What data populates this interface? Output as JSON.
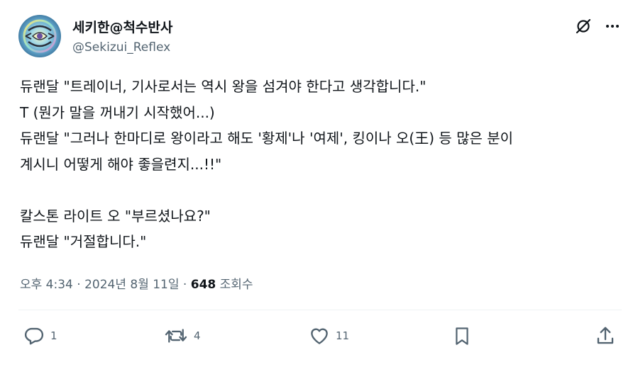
{
  "author": {
    "display_name": "세키한@척수반사",
    "handle": "@Sekizui_Reflex"
  },
  "tweet": {
    "lines": [
      "듀랜달 \"트레이너, 기사로서는 역시 왕을 섬겨야 한다고 생각합니다.\"",
      "T (뭔가 말을 꺼내기 시작했어...)",
      "듀랜달 \"그러나 한마디로 왕이라고 해도 '황제'나 '여제', 킹이나 오(王) 등 많은 분이",
      "계시니 어떻게 해야 좋을련지...!!\"",
      "",
      "칼스톤 라이트 오 \"부르셨나요?\"",
      "듀랜달 \"거절합니다.\""
    ]
  },
  "meta": {
    "timestamp": "오후 4:34 · 2024년 8월 11일 · ",
    "views_count": "648",
    "views_label": " 조회수"
  },
  "actions": {
    "reply_count": "1",
    "retweet_count": "4",
    "like_count": "11"
  },
  "icons": {
    "top_right": [
      "grok-icon",
      "more-icon"
    ],
    "actions": [
      "reply-icon",
      "retweet-icon",
      "like-icon",
      "bookmark-icon",
      "share-icon"
    ]
  },
  "colors": {
    "text_primary": "#0f1419",
    "text_secondary": "#536471",
    "divider": "#eff3f4"
  }
}
